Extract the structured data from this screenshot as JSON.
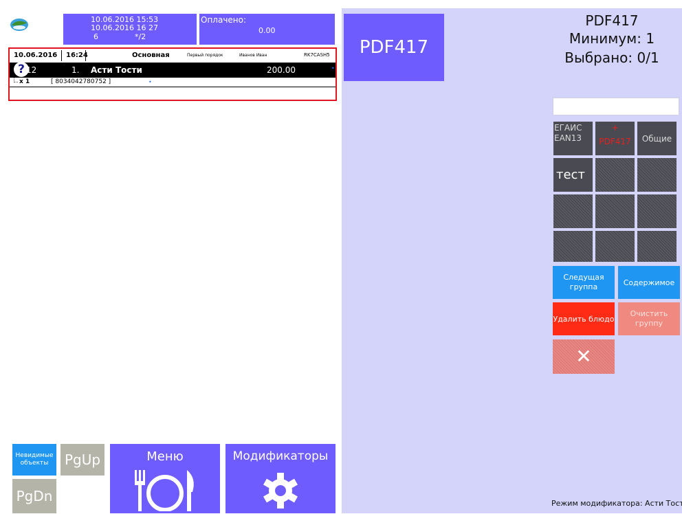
{
  "header": {
    "date1": "10.06.2016 15:53",
    "date2": "10.06.2016 16 27",
    "guests": "6",
    "table": "*/2",
    "paid_label": "Оплачено:",
    "paid_value": "0.00"
  },
  "order": {
    "date": "10.06.2016",
    "time": "16:24",
    "menu": "Основная",
    "order_type": "Первый порядок",
    "waiter": "Иванов Иван",
    "station": "RK7CASH5",
    "line_no": "12",
    "course": "1.",
    "item_name": "Асти Тости",
    "item_price": "200.00",
    "qty": "x 1",
    "barcode": "[ 8034042780752 ]",
    "help_mark": "?",
    "dot": "•"
  },
  "bottom": {
    "invisible_objects": "Невидимые объекты",
    "pgup": "PgUp",
    "pgdn": "PgDn",
    "menu": "Меню",
    "modifiers": "Модификаторы"
  },
  "center": {
    "pdf417_button": "PDF417"
  },
  "right": {
    "title": "PDF417",
    "minimum": "Минимум: 1",
    "selected": "Выбрано: 0/1",
    "groups": {
      "egais": "ЕГАИС EAN13",
      "pdf417": "PDF417",
      "pdf417_marker": "+",
      "common": "Общие"
    },
    "test": "тест",
    "next_group": "Следущая группа",
    "contents": "Содержимое",
    "delete_dish": "Удалить блюдо",
    "clear_group": "Очистить группу",
    "close": "✕",
    "status": "Режим модификатора: Асти Тост"
  },
  "colors": {
    "tile_purple": "#6e5cff",
    "panel_lavender": "#d4d4fa",
    "tile_blue": "#1f97f2",
    "tile_red": "#ff2b14",
    "tile_gray": "#4a4a52",
    "highlight_red": "#e0141e"
  },
  "icons": [
    "app-logo-icon",
    "help-icon",
    "plate-cutlery-icon",
    "gear-icon",
    "close-icon"
  ]
}
